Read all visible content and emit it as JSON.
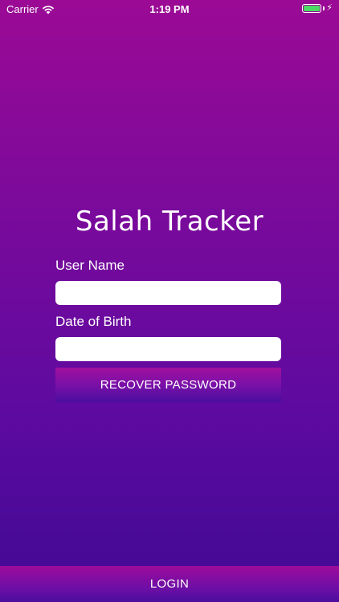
{
  "status_bar": {
    "carrier": "Carrier",
    "time": "1:19 PM",
    "battery_level": 1.0,
    "battery_color": "#4cd964"
  },
  "app": {
    "title": "Salah Tracker"
  },
  "form": {
    "username_label": "User Name",
    "username_value": "",
    "dob_label": "Date of Birth",
    "dob_value": "",
    "recover_button_label": "RECOVER PASSWORD"
  },
  "footer": {
    "login_label": "LOGIN"
  },
  "colors": {
    "gradient_top": "#9b0a95",
    "gradient_bottom": "#400a93"
  }
}
